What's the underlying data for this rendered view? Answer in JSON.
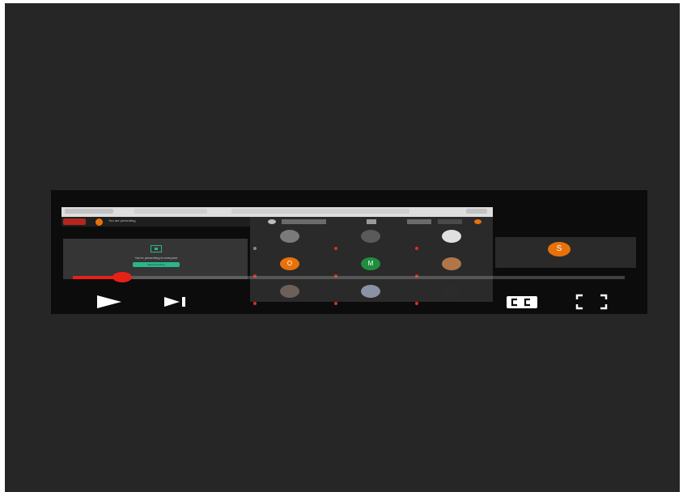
{
  "player": {
    "progress_fraction": 0.09,
    "icons": {
      "play": "play-icon",
      "next": "skip-next-icon",
      "captions": "closed-captions-icon",
      "fullscreen": "fullscreen-icon"
    },
    "colors": {
      "progress": "#e62117",
      "backdrop": "#262626",
      "player_bg": "#0c0c0c"
    }
  },
  "meeting": {
    "presenting_text": "You are presenting",
    "panel_text": "You're presenting to everyone",
    "stop_button": "Stop presenting",
    "participants": [
      {
        "avatar": "",
        "color": "#7a7a7a"
      },
      {
        "avatar": "",
        "color": "#5a5a5a"
      },
      {
        "avatar": "",
        "color": "#e0e0e0"
      },
      {
        "avatar": "O",
        "color": "#e8710a"
      },
      {
        "avatar": "M",
        "color": "#1e8e3e"
      },
      {
        "avatar": "",
        "color": "#b0764a"
      },
      {
        "avatar": "",
        "color": "#6d6059"
      },
      {
        "avatar": "",
        "color": "#8a93a3"
      },
      {
        "avatar": "",
        "color": "#2b2b2b"
      }
    ],
    "speaker_avatar": "S",
    "speaker_color": "#e8710a"
  }
}
